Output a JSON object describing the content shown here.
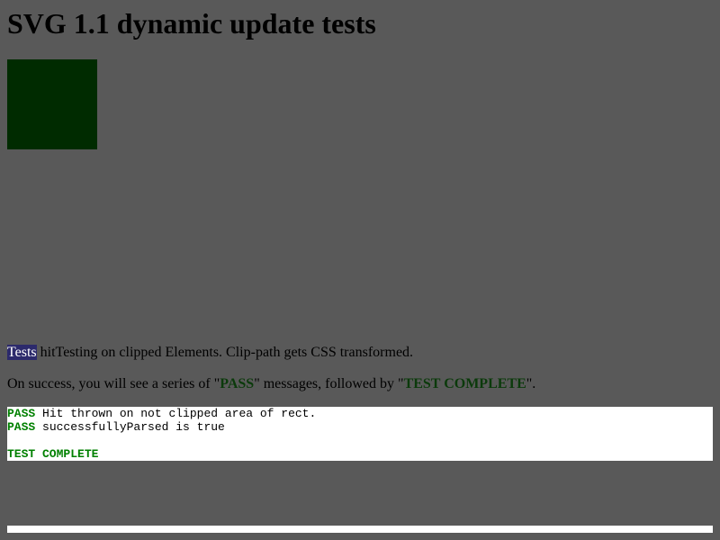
{
  "page": {
    "title": "SVG 1.1 dynamic update tests",
    "background": "#595959"
  },
  "test_rect": {
    "fill": "#002b00"
  },
  "description": {
    "highlighted_word": "Tests",
    "rest": " hitTesting on clipped Elements. Clip-path gets CSS transformed."
  },
  "instructions": {
    "prefix": "On success, you will see a series of \"",
    "pass_keyword": "PASS",
    "middle": "\" messages, followed by \"",
    "complete_keyword": "TEST COMPLETE",
    "suffix": "\".",
    "keyword_color": "#0b3a0b"
  },
  "console": {
    "lines": [
      {
        "status": "PASS",
        "message": " Hit thrown on not clipped area of rect."
      },
      {
        "status": "PASS",
        "message": " successfullyParsed is true"
      }
    ],
    "complete_text": "TEST COMPLETE",
    "pass_color": "#008000"
  }
}
